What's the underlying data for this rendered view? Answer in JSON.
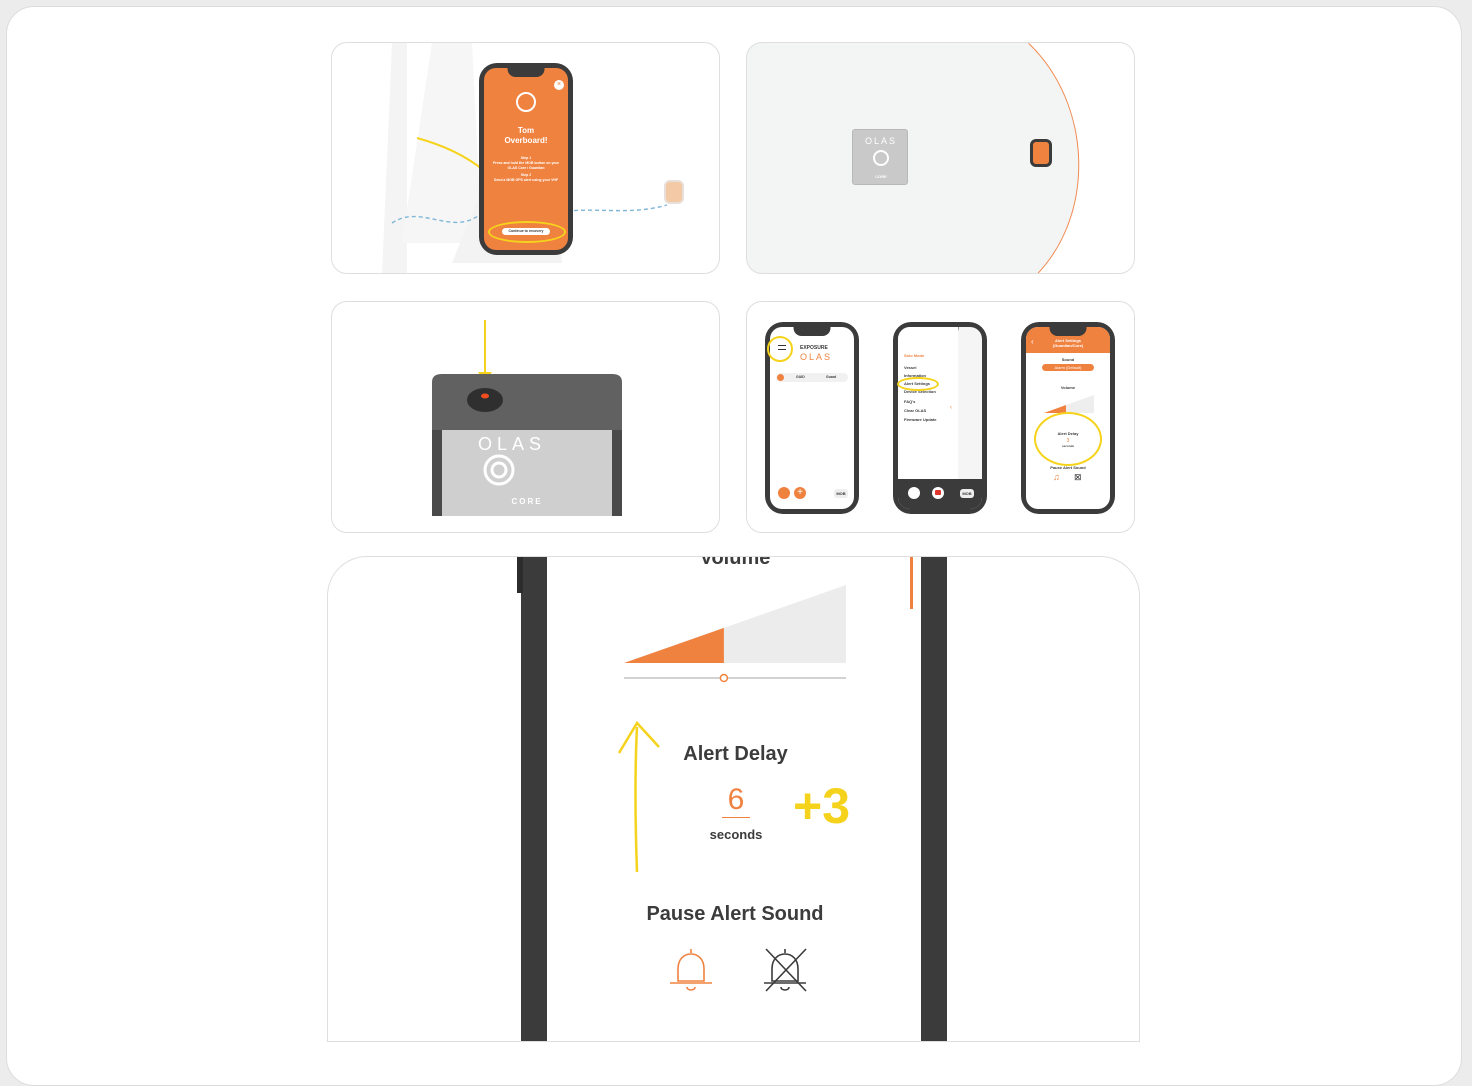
{
  "panel1": {
    "title_line1": "Tom",
    "title_line2": "Overboard!",
    "step1_label": "Step 1",
    "step1_text": "Press and hold the MOB button on your OLAS Core / Guardian",
    "step2_label": "Step 2",
    "step2_text": "Send a MOB GPS alert using your VHF",
    "cta": "Continue to recovery"
  },
  "panel2": {
    "device_logo": "OLAS",
    "device_label": "CORE"
  },
  "panel3": {
    "device_logo": "OLAS",
    "device_label": "CORE"
  },
  "panel4": {
    "phone_a": {
      "brand_top": "EXPOSURE",
      "brand_bottom": "OLAS",
      "row_left": "GUID",
      "row_right": "Guard",
      "mob": "MOB"
    },
    "phone_b": {
      "menu": [
        "Solo Mode",
        "Vessel",
        "Information",
        "Alert Settings",
        "Device Selection",
        "FAQ's",
        "Clear OLAS",
        "Firmware Update"
      ],
      "mob": "MOB"
    },
    "phone_c": {
      "header_line1": "Alert Settings",
      "header_line2": "(Guardian/Core)",
      "sound_label": "Sound",
      "sound_value": "Alarm (Default)",
      "volume_label": "Volume",
      "delay_label": "Alert Delay",
      "delay_value": "3",
      "delay_unit": "seconds",
      "pause_label": "Pause Alert Sound"
    }
  },
  "panel5": {
    "volume_label": "Volume",
    "delay_label": "Alert Delay",
    "delay_value": "6",
    "delay_unit": "seconds",
    "delta": "+3",
    "pause_label": "Pause Alert Sound",
    "volume_level": 0.45
  },
  "colors": {
    "accent": "#f08240",
    "highlight": "#f5d31c",
    "dark": "#3b3b3b"
  }
}
